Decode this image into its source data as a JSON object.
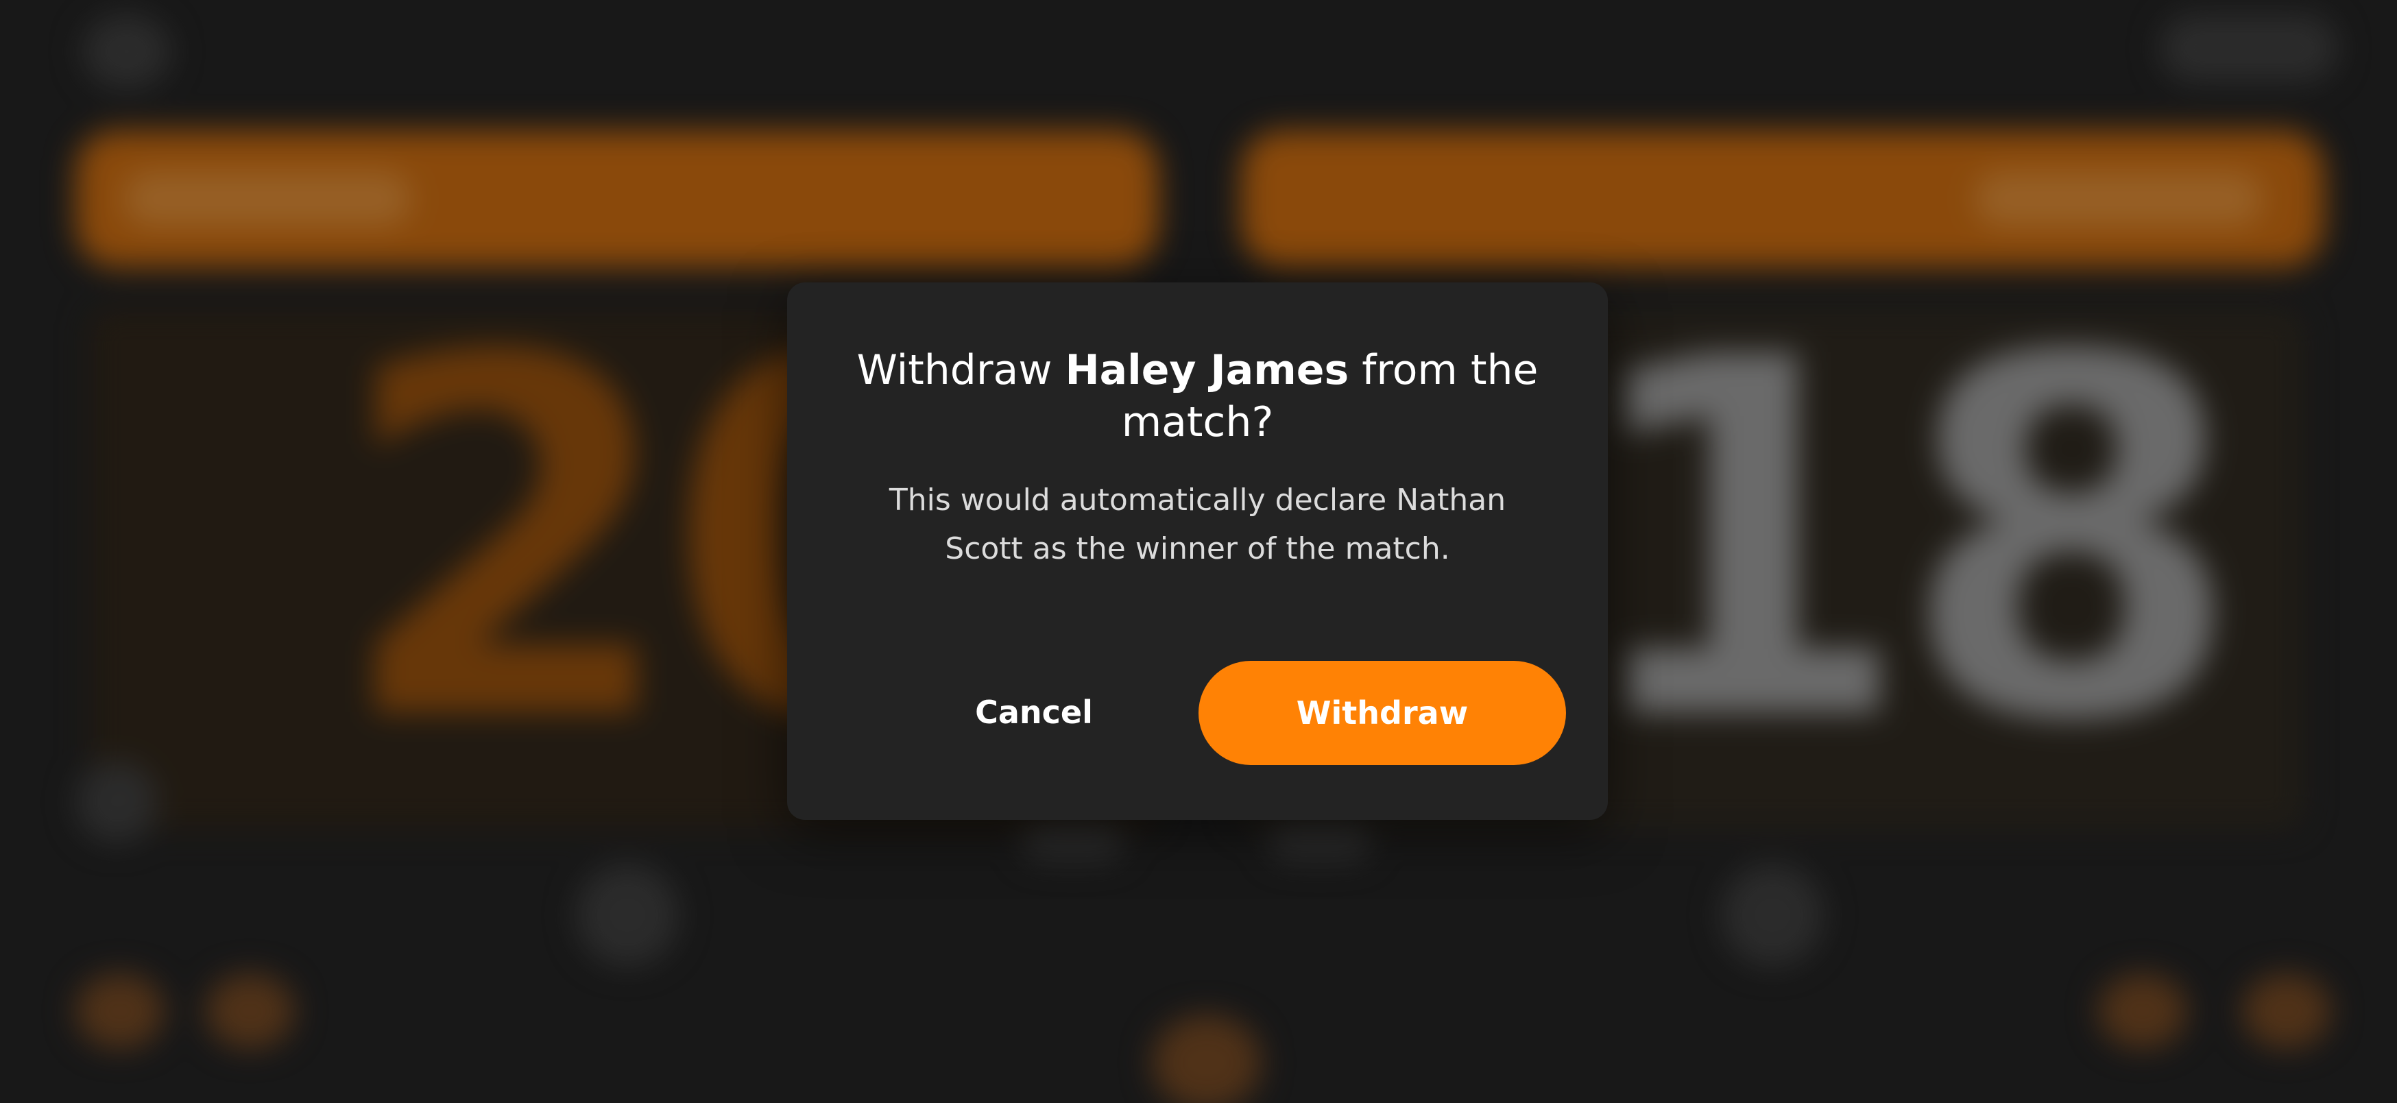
{
  "background": {
    "player_left_score": "20",
    "player_right_score": "18"
  },
  "dialog": {
    "title_prefix": "Withdraw ",
    "title_name": "Haley James",
    "title_suffix": " from the match?",
    "body": "This would automatically declare Nathan Scott as the winner of the match.",
    "cancel_label": "Cancel",
    "withdraw_label": "Withdraw"
  },
  "colors": {
    "accent": "#ff8205",
    "dialog_background": "#232323",
    "page_background": "#202020"
  }
}
